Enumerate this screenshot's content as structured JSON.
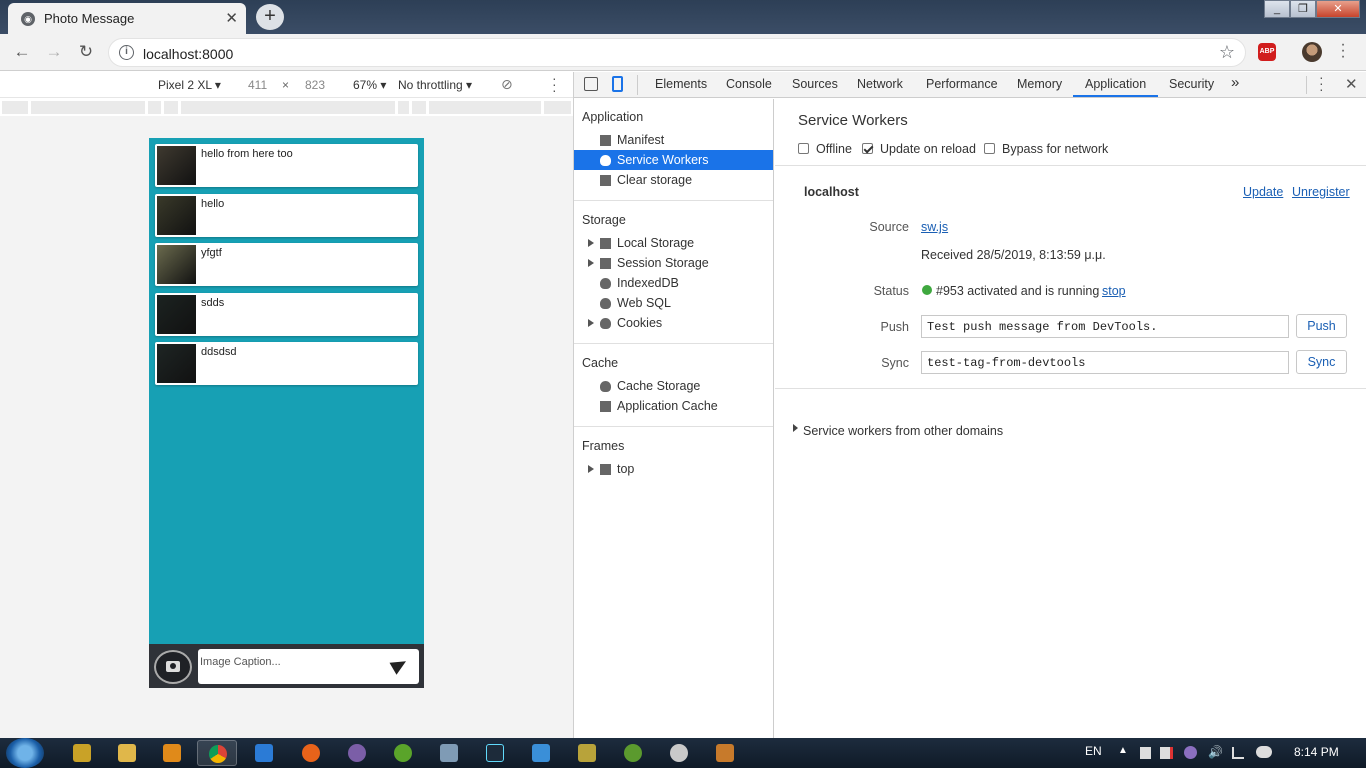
{
  "browser": {
    "tab_title": "Photo Message",
    "url": "localhost:8000",
    "abp_label": "ABP"
  },
  "device_toolbar": {
    "device": "Pixel 2 XL",
    "width": "411",
    "times": "×",
    "height": "823",
    "zoom": "67%",
    "throttling": "No throttling"
  },
  "app": {
    "messages": [
      {
        "caption": "hello from here too",
        "thumb": "#3f3a30"
      },
      {
        "caption": "hello",
        "thumb": "#3a3a2a"
      },
      {
        "caption": "yfgtf",
        "thumb": "#6b6b4e"
      },
      {
        "caption": "sdds",
        "thumb": "#1c2321"
      },
      {
        "caption": "ddsdsd",
        "thumb": "#1e2524"
      }
    ],
    "caption_placeholder": "Image Caption..."
  },
  "devtools": {
    "tabs": [
      "Elements",
      "Console",
      "Sources",
      "Network",
      "Performance",
      "Memory",
      "Application",
      "Security"
    ],
    "more": "»",
    "active_tab": "Application",
    "sidebar": {
      "application_header": "Application",
      "application_items": [
        "Manifest",
        "Service Workers",
        "Clear storage"
      ],
      "storage_header": "Storage",
      "storage_items": [
        "Local Storage",
        "Session Storage",
        "IndexedDB",
        "Web SQL",
        "Cookies"
      ],
      "cache_header": "Cache",
      "cache_items": [
        "Cache Storage",
        "Application Cache"
      ],
      "frames_header": "Frames",
      "frames_items": [
        "top"
      ]
    },
    "panel": {
      "title": "Service Workers",
      "checkboxes": [
        {
          "label": "Offline",
          "checked": false
        },
        {
          "label": "Update on reload",
          "checked": true
        },
        {
          "label": "Bypass for network",
          "checked": false
        }
      ],
      "origin": "localhost",
      "update_link": "Update",
      "unregister_link": "Unregister",
      "source_label": "Source",
      "source_link": "sw.js",
      "received": "Received 28/5/2019, 8:13:59 μ.μ.",
      "status_label": "Status",
      "status_text": "#953 activated and is running",
      "status_color": "#3fa83f",
      "stop_link": "stop",
      "push_label": "Push",
      "push_value": "Test push message from DevTools.",
      "push_button": "Push",
      "sync_label": "Sync",
      "sync_value": "test-tag-from-devtools",
      "sync_button": "Sync",
      "other_domains": "Service workers from other domains"
    }
  },
  "taskbar": {
    "lang": "EN",
    "time": "8:14 PM"
  },
  "colors": {
    "accent": "#1a73e8",
    "app_bg": "#17a0b4"
  }
}
